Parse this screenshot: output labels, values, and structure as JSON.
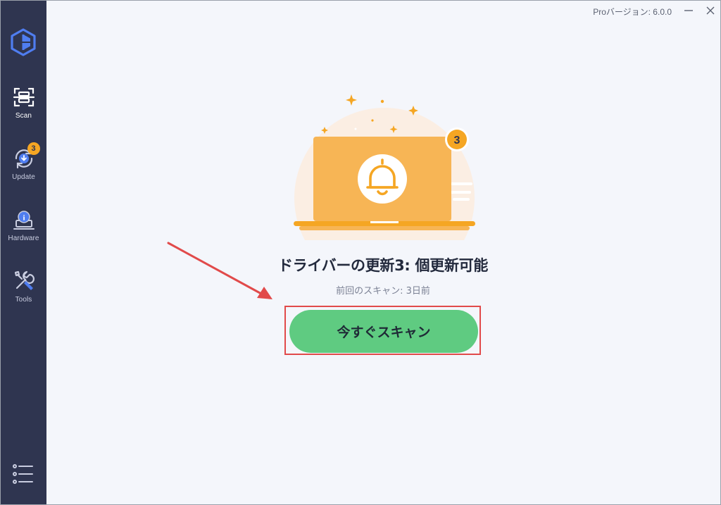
{
  "titlebar": {
    "version_text": "Proバージョン: 6.0.0",
    "minimize_glyph": "—",
    "close_glyph": "✕"
  },
  "sidebar": {
    "items": [
      {
        "label": "Scan",
        "icon": "scan-icon",
        "active": true
      },
      {
        "label": "Update",
        "icon": "update-icon",
        "badge": "3"
      },
      {
        "label": "Hardware",
        "icon": "hardware-icon"
      },
      {
        "label": "Tools",
        "icon": "tools-icon"
      }
    ],
    "menu_icon": "menu-list-icon"
  },
  "main": {
    "illustration_badge": "3",
    "headline": "ドライバーの更新3: 個更新可能",
    "last_scan": "前回のスキャン: 3日前",
    "scan_button_label": "今すぐスキャン"
  },
  "colors": {
    "sidebar_bg": "#2f3550",
    "background": "#f4f6fb",
    "accent_orange": "#f5a623",
    "scan_button": "#5fcb81",
    "annotation_red": "#e14a4a"
  }
}
